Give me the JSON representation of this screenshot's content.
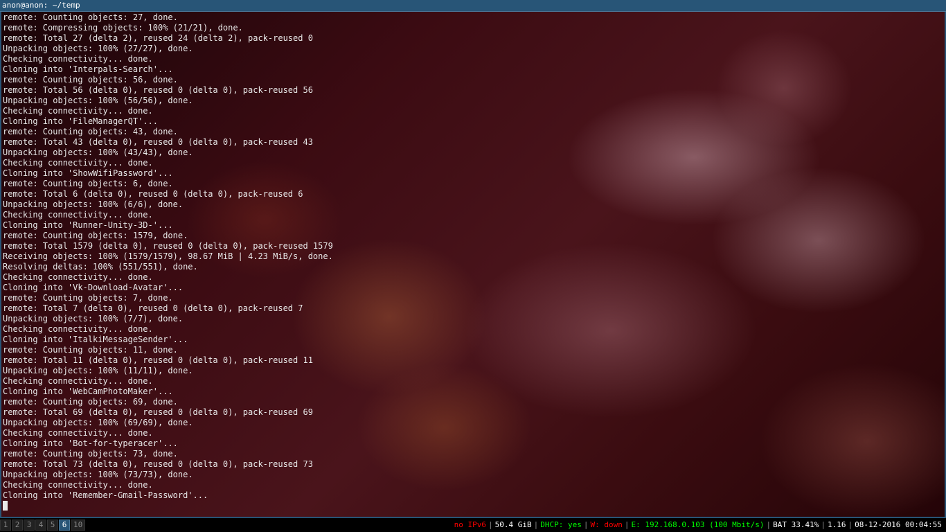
{
  "window": {
    "title": "anon@anon: ~/temp"
  },
  "terminal": {
    "lines": [
      "remote: Counting objects: 27, done.",
      "remote: Compressing objects: 100% (21/21), done.",
      "remote: Total 27 (delta 2), reused 24 (delta 2), pack-reused 0",
      "Unpacking objects: 100% (27/27), done.",
      "Checking connectivity... done.",
      "Cloning into 'Interpals-Search'...",
      "remote: Counting objects: 56, done.",
      "remote: Total 56 (delta 0), reused 0 (delta 0), pack-reused 56",
      "Unpacking objects: 100% (56/56), done.",
      "Checking connectivity... done.",
      "Cloning into 'FileManagerQT'...",
      "remote: Counting objects: 43, done.",
      "remote: Total 43 (delta 0), reused 0 (delta 0), pack-reused 43",
      "Unpacking objects: 100% (43/43), done.",
      "Checking connectivity... done.",
      "Cloning into 'ShowWifiPassword'...",
      "remote: Counting objects: 6, done.",
      "remote: Total 6 (delta 0), reused 0 (delta 0), pack-reused 6",
      "Unpacking objects: 100% (6/6), done.",
      "Checking connectivity... done.",
      "Cloning into 'Runner-Unity-3D-'...",
      "remote: Counting objects: 1579, done.",
      "remote: Total 1579 (delta 0), reused 0 (delta 0), pack-reused 1579",
      "Receiving objects: 100% (1579/1579), 98.67 MiB | 4.23 MiB/s, done.",
      "Resolving deltas: 100% (551/551), done.",
      "Checking connectivity... done.",
      "Cloning into 'Vk-Download-Avatar'...",
      "remote: Counting objects: 7, done.",
      "remote: Total 7 (delta 0), reused 0 (delta 0), pack-reused 7",
      "Unpacking objects: 100% (7/7), done.",
      "Checking connectivity... done.",
      "Cloning into 'ItalkiMessageSender'...",
      "remote: Counting objects: 11, done.",
      "remote: Total 11 (delta 0), reused 0 (delta 0), pack-reused 11",
      "Unpacking objects: 100% (11/11), done.",
      "Checking connectivity... done.",
      "Cloning into 'WebCamPhotoMaker'...",
      "remote: Counting objects: 69, done.",
      "remote: Total 69 (delta 0), reused 0 (delta 0), pack-reused 69",
      "Unpacking objects: 100% (69/69), done.",
      "Checking connectivity... done.",
      "Cloning into 'Bot-for-typeracer'...",
      "remote: Counting objects: 73, done.",
      "remote: Total 73 (delta 0), reused 0 (delta 0), pack-reused 73",
      "Unpacking objects: 100% (73/73), done.",
      "Checking connectivity... done.",
      "Cloning into 'Remember-Gmail-Password'..."
    ]
  },
  "workspaces": [
    {
      "label": "1",
      "focused": false
    },
    {
      "label": "2",
      "focused": false
    },
    {
      "label": "3",
      "focused": false
    },
    {
      "label": "4",
      "focused": false
    },
    {
      "label": "5",
      "focused": false
    },
    {
      "label": "6",
      "focused": true
    },
    {
      "label": "10",
      "focused": false
    }
  ],
  "status": {
    "ipv6": "no IPv6",
    "disk": "50.4 GiB",
    "dhcp": "DHCP: yes",
    "wireless": "W: down",
    "ethernet": "E: 192.168.0.103 (100 Mbit/s)",
    "battery": "BAT 33.41%",
    "load": "1.16",
    "datetime": "08-12-2016 00:04:55",
    "colors": {
      "ipv6": "#ff0000",
      "disk": "#ffffff",
      "dhcp": "#00ff00",
      "wireless": "#ff0000",
      "ethernet": "#00ff00",
      "battery": "#ffffff",
      "load": "#ffffff",
      "datetime": "#ffffff"
    }
  }
}
